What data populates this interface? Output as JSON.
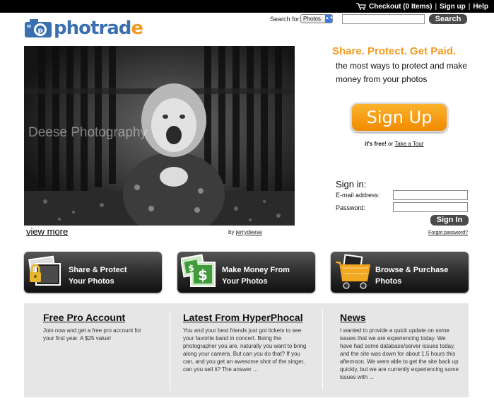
{
  "topbar": {
    "checkout": "Checkout (0 Items)",
    "signup": "Sign up",
    "help": "Help"
  },
  "logo": {
    "text": "photrade"
  },
  "search": {
    "label": "Search for:",
    "category": "Photos",
    "query": "",
    "button": "Search"
  },
  "hero": {
    "watermark": "Deese Photography",
    "view_more": "view more",
    "credit_prefix": "by",
    "credit_user": "jerrydeese"
  },
  "promo": {
    "tagline": "Share. Protect. Get Paid.",
    "text": "the most ways to protect and make money from your photos",
    "signup_button": "Sign Up",
    "free_text": "it's free!",
    "or_text": "or",
    "tour_link": "Take a Tour"
  },
  "signin": {
    "title": "Sign in:",
    "email_label": "E-mail address:",
    "email_value": "",
    "password_label": "Password:",
    "password_value": "",
    "button": "Sign In",
    "forgot": "Forgot password?"
  },
  "features": [
    {
      "line1": "Share & Protect",
      "line2": "Your Photos",
      "icon": "lock-photo-icon"
    },
    {
      "line1": "Make Money From",
      "line2": "Your Photos",
      "icon": "money-photo-icon"
    },
    {
      "line1": "Browse & Purchase",
      "line2": "Photos",
      "icon": "shopping-cart-icon"
    }
  ],
  "columns": [
    {
      "title": "Free Pro Account",
      "body": "Join now and get a free pro account for your first year. A $25 value!"
    },
    {
      "title": "Latest From HyperPhocal",
      "body": "You and your best friends just got tickets to see your favorite band in concert. Being the photographer you are, naturally you want to bring along your camera. But can you do that? If you can, and you get an awesome shot of the singer, can you sell it? The answer ..."
    },
    {
      "title": "News",
      "body": "I wanted to provide a quick update on some issues that we are experiencing today.  We have had some database/server issues today, and the site was down for about 1.5 hours this afternoon. We were able to get the site back up quickly, but we are currently experiencing some issues with ..."
    }
  ],
  "colors": {
    "accent_orange": "#f29a1e",
    "logo_blue": "#3a6fb0",
    "button_dark": "#4a4a4a",
    "panel_gray": "#e6e6e6"
  }
}
